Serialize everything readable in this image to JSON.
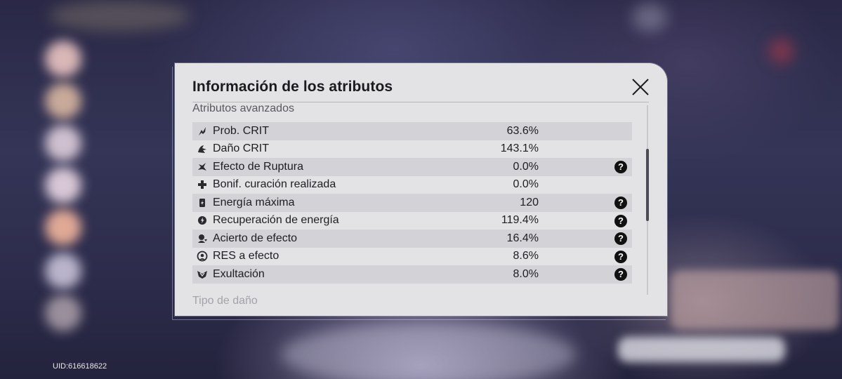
{
  "dialog": {
    "title": "Información de los atributos",
    "section_title": "Atributos avanzados",
    "next_section_title": "Tipo de daño",
    "rows": [
      {
        "label": "Prob. CRIT",
        "value": "63.6%",
        "icon": "crit-rate-icon",
        "help": false
      },
      {
        "label": "Daño CRIT",
        "value": "143.1%",
        "icon": "crit-dmg-icon",
        "help": false
      },
      {
        "label": "Efecto de Ruptura",
        "value": "0.0%",
        "icon": "break-effect-icon",
        "help": true
      },
      {
        "label": "Bonif. curación realizada",
        "value": "0.0%",
        "icon": "healing-bonus-icon",
        "help": false
      },
      {
        "label": "Energía máxima",
        "value": "120",
        "icon": "max-energy-icon",
        "help": true
      },
      {
        "label": "Recuperación de energía",
        "value": "119.4%",
        "icon": "energy-regen-icon",
        "help": true
      },
      {
        "label": "Acierto de efecto",
        "value": "16.4%",
        "icon": "effect-hit-icon",
        "help": true
      },
      {
        "label": "RES a efecto",
        "value": "8.6%",
        "icon": "effect-res-icon",
        "help": true
      },
      {
        "label": "Exultación",
        "value": "8.0%",
        "icon": "exultation-icon",
        "help": true
      }
    ],
    "help_glyph": "?"
  },
  "footer": {
    "uid": "UID:616618622"
  },
  "colors": {
    "dialog_bg": "#e3e3e6",
    "row_shade": "#d3d3d7",
    "text": "#1e1e22",
    "help_bg": "#111111"
  }
}
